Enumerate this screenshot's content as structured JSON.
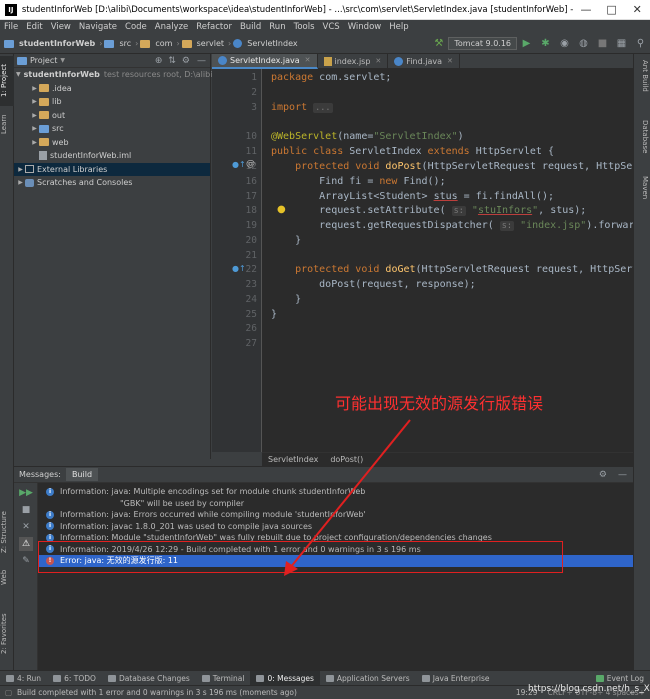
{
  "window": {
    "title": "studentInforWeb [D:\\alibi\\Documents\\workspace\\idea\\studentInforWeb] - ...\\src\\com\\servlet\\ServletIndex.java [studentInforWeb] - Int...",
    "app_icon_text": "IJ"
  },
  "menu": [
    "File",
    "Edit",
    "View",
    "Navigate",
    "Code",
    "Analyze",
    "Refactor",
    "Build",
    "Run",
    "Tools",
    "VCS",
    "Window",
    "Help"
  ],
  "navbar": {
    "crumbs": [
      "studentInforWeb",
      "src",
      "com",
      "servlet",
      "ServletIndex"
    ],
    "run_config": "Tomcat 9.0.16"
  },
  "left_strip": {
    "project_tab": "1: Project",
    "learn_tab": "Learn",
    "structure_tab": "Z: Structure",
    "web_tab": "Web",
    "favorites_tab": "2: Favorites"
  },
  "right_strip": {
    "ant_tab": "Ant Build",
    "database_tab": "Database",
    "maven_tab": "Maven"
  },
  "project": {
    "header": "Project",
    "items": [
      {
        "label": "studentInforWeb",
        "hint": "test resources root, D:\\alibi\\D",
        "indent": 0,
        "arrow": "▼",
        "icon": "folder-blue"
      },
      {
        "label": ".idea",
        "indent": 1,
        "arrow": "▶",
        "icon": "folder"
      },
      {
        "label": "lib",
        "indent": 1,
        "arrow": "▶",
        "icon": "folder"
      },
      {
        "label": "out",
        "indent": 1,
        "arrow": "▶",
        "icon": "folder"
      },
      {
        "label": "src",
        "indent": 1,
        "arrow": "▶",
        "icon": "folder-blue"
      },
      {
        "label": "web",
        "indent": 1,
        "arrow": "▶",
        "icon": "folder"
      },
      {
        "label": "studentInforWeb.iml",
        "indent": 1,
        "arrow": "",
        "icon": "file"
      },
      {
        "label": "External Libraries",
        "indent": 0,
        "arrow": "▶",
        "icon": "library",
        "selected": true
      },
      {
        "label": "Scratches and Consoles",
        "indent": 0,
        "arrow": "▶",
        "icon": "scratch"
      }
    ]
  },
  "tabs": [
    {
      "label": "ServletIndex.java",
      "active": true
    },
    {
      "label": "index.jsp",
      "active": false
    },
    {
      "label": "Find.java",
      "active": false
    }
  ],
  "editor": {
    "line_numbers": [
      "1",
      "2",
      "3",
      "10",
      "11",
      "12",
      "16",
      "17",
      "18",
      "19",
      "20",
      "21",
      "22",
      "23",
      "24",
      "25",
      "26",
      "27"
    ],
    "hint_s": "s:",
    "hint_s2": "s:",
    "breadcrumb": [
      "ServletIndex",
      "doPost()"
    ]
  },
  "messages": {
    "panel_label": "Messages:",
    "build_tab": "Build",
    "items": [
      {
        "type": "info",
        "text": "Information: java: Multiple encodings set for module chunk studentInforWeb"
      },
      {
        "type": "cont",
        "text": "\"GBK\" will be used by compiler"
      },
      {
        "type": "info",
        "text": "Information: java: Errors occurred while compiling module 'studentInforWeb'"
      },
      {
        "type": "info",
        "text": "Information: javac 1.8.0_201 was used to compile java sources"
      },
      {
        "type": "info",
        "text": "Information: Module \"studentInforWeb\" was fully rebuilt due to project configuration/dependencies changes"
      },
      {
        "type": "info",
        "text": "Information: 2019/4/26 12:29 - Build completed with 1 error and 0 warnings in 3 s 196 ms"
      },
      {
        "type": "err",
        "text": "Error: java: 无效的源发行版: 11",
        "selected": true
      }
    ]
  },
  "annotation": {
    "text": "可能出现无效的源发行版错误"
  },
  "bottom_tabs": [
    "4: Run",
    "6: TODO",
    "Database Changes",
    "Terminal",
    "0: Messages",
    "Application Servers",
    "Java Enterprise",
    "Event Log"
  ],
  "status": {
    "message": "Build completed with 1 error and 0 warnings in 3 s 196 ms (moments ago)",
    "position": "19:29",
    "encoding": "CRLF÷ UTF-8÷ 4 spaces÷",
    "watermark": "https://blog.csdn.net/h_s_X14"
  },
  "colors": {
    "accent": "#2f65ca",
    "error": "#c75450",
    "annotation_red": "#ff3030"
  }
}
